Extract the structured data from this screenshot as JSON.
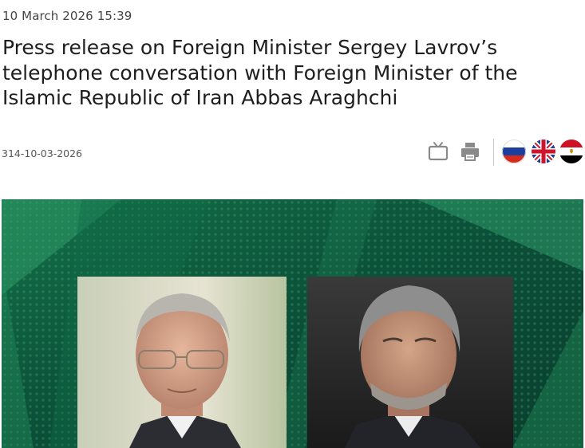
{
  "article": {
    "date": "10 March 2026 15:39",
    "title": "Press release on Foreign Minister Sergey Lavrov’s telephone conversation with Foreign Minister of the Islamic Republic of Iran Abbas Araghchi",
    "doc_number": "314-10-03-2026"
  },
  "toolbar": {
    "tv_icon": "tv-icon",
    "print_icon": "printer-icon"
  },
  "languages": [
    {
      "code": "ru",
      "icon": "russia-flag-icon"
    },
    {
      "code": "en",
      "icon": "uk-flag-icon"
    },
    {
      "code": "ar",
      "icon": "egypt-flag-icon"
    }
  ],
  "colors": {
    "hero_green": "#0f5a3e",
    "hero_light_green": "#3fae7c"
  }
}
